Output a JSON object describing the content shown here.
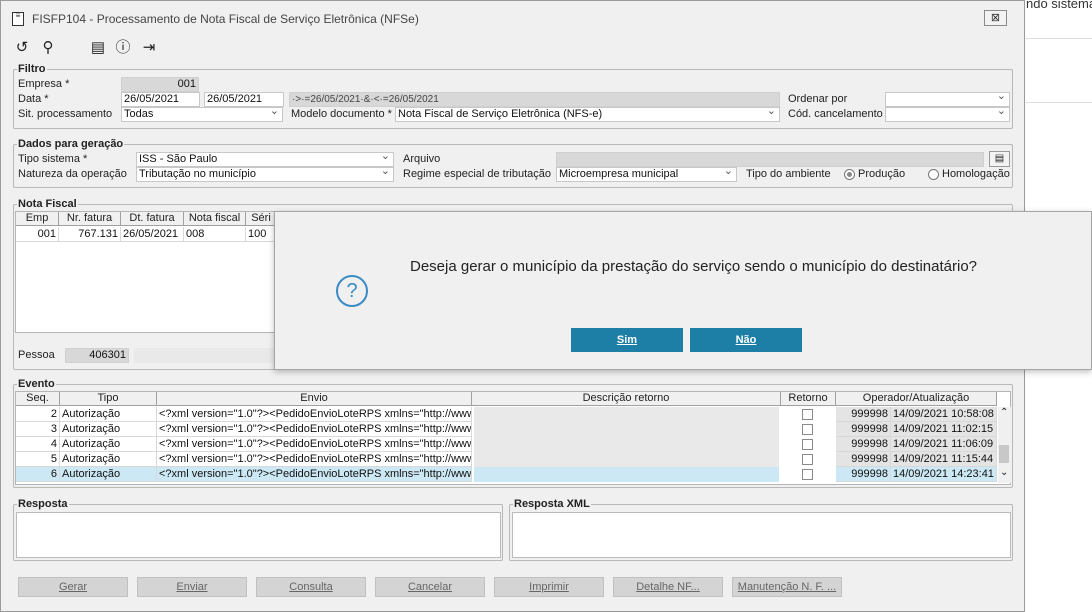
{
  "background": {
    "partial_text": "ndo sistema"
  },
  "window": {
    "title": "FISFP104 - Processamento de Nota Fiscal de Serviço Eletrônica (NFSe)",
    "close_symbol": "⊠"
  },
  "toolbar": {
    "icons": [
      "undo-icon",
      "search-icon",
      "calendar-icon",
      "help-icon",
      "exit-icon"
    ]
  },
  "filtro": {
    "legend": "Filtro",
    "empresa_label": "Empresa *",
    "empresa_value": "001",
    "data_label": "Data *",
    "data_from": "26/05/2021",
    "data_to": "26/05/2021",
    "data_expr": "·>·=26/05/2021·&·<·=26/05/2021",
    "sit_label": "Sit. processamento",
    "sit_value": "Todas",
    "modelo_label": "Modelo documento *",
    "modelo_value": "Nota Fiscal de Serviço Eletrônica (NFS-e)",
    "ordenar_label": "Ordenar por",
    "ordenar_value": "",
    "cancel_label": "Cód. cancelamento",
    "cancel_value": ""
  },
  "geracao": {
    "legend": "Dados para geração",
    "tipo_label": "Tipo sistema *",
    "tipo_value": "ISS - São Paulo",
    "natureza_label": "Natureza da operação",
    "natureza_value": "Tributação no município",
    "arquivo_label": "Arquivo",
    "arquivo_value": "",
    "regime_label": "Regime especial de tributação",
    "regime_value": "Microempresa municipal",
    "ambiente_label": "Tipo do ambiente",
    "producao_label": "Produção",
    "homologacao_label": "Homologação",
    "ambiente_selected": "Produção"
  },
  "nota_fiscal": {
    "legend": "Nota Fiscal",
    "columns": [
      "Emp",
      "Nr. fatura",
      "Dt. fatura",
      "Nota fiscal",
      "Séri"
    ],
    "rows": [
      [
        "001",
        "767.131",
        "26/05/2021",
        "008",
        "100"
      ]
    ],
    "pessoa_label": "Pessoa",
    "pessoa_value": "406301"
  },
  "evento": {
    "legend": "Evento",
    "columns": [
      "Seq.",
      "Tipo",
      "Envio",
      "Descrição retorno",
      "Retorno",
      "Operador/Atualização"
    ],
    "rows": [
      {
        "seq": "2",
        "tipo": "Autorização",
        "envio": "<?xml version=\"1.0\"?><PedidoEnvioLoteRPS xmlns=\"http://www",
        "op": "999998",
        "dt": "14/09/2021 10:58:08"
      },
      {
        "seq": "3",
        "tipo": "Autorização",
        "envio": "<?xml version=\"1.0\"?><PedidoEnvioLoteRPS xmlns=\"http://www",
        "op": "999998",
        "dt": "14/09/2021 11:02:15"
      },
      {
        "seq": "4",
        "tipo": "Autorização",
        "envio": "<?xml version=\"1.0\"?><PedidoEnvioLoteRPS xmlns=\"http://www",
        "op": "999998",
        "dt": "14/09/2021 11:06:09"
      },
      {
        "seq": "5",
        "tipo": "Autorização",
        "envio": "<?xml version=\"1.0\"?><PedidoEnvioLoteRPS xmlns=\"http://www",
        "op": "999998",
        "dt": "14/09/2021 11:15:44"
      },
      {
        "seq": "6",
        "tipo": "Autorização",
        "envio": "<?xml version=\"1.0\"?><PedidoEnvioLoteRPS xmlns=\"http://www",
        "op": "999998",
        "dt": "14/09/2021 14:23:41"
      }
    ],
    "selected_seq": "6"
  },
  "resposta": {
    "legend": "Resposta"
  },
  "resposta_xml": {
    "legend": "Resposta XML"
  },
  "buttons": [
    "Gerar",
    "Enviar",
    "Consulta",
    "Cancelar",
    "Imprimir",
    "Detalhe NF...",
    "Manutenção N. F. ..."
  ],
  "dialog": {
    "message": "Deseja gerar o município da prestação do serviço sendo o município do destinatário?",
    "icon": "question-icon",
    "yes": "Sim",
    "no": "Não",
    "accent": "#1e7fa6"
  }
}
